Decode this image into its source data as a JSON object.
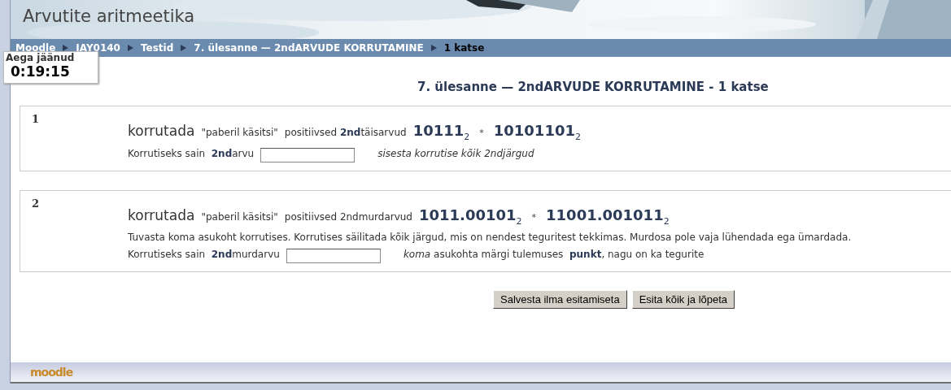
{
  "header": {
    "title": "Arvutite aritmeetika"
  },
  "breadcrumb": [
    {
      "label": "Moodle",
      "current": false
    },
    {
      "label": "IAY0140",
      "current": false
    },
    {
      "label": "Testid",
      "current": false
    },
    {
      "label": "7. ülesanne — 2ndARVUDE KORRUTAMINE",
      "current": false
    },
    {
      "label": "1 katse",
      "current": true
    }
  ],
  "timer": {
    "label": "Aega jäänud",
    "value": "0:19:15"
  },
  "heading": "7. ülesanne — 2ndARVUDE KORRUTAMINE - 1 katse",
  "questions": [
    {
      "number": "1",
      "verb": "korrutada",
      "quote": "\"paberil käsitsi\"",
      "kind_text": "positiivsed **2nd**täisarvud",
      "operand_a": "10111$_{2}$",
      "operator": "*",
      "operand_b": "10101101$_{2}$",
      "answer_label": "Korrutiseks sain  **2nd**arvu",
      "hint": "*sisesta korrutise kõik 2ndjärgud*"
    },
    {
      "number": "2",
      "verb": "korrutada",
      "quote": "\"paberil käsitsi\"",
      "kind_text": "positiivsed 2ndmurdarvud",
      "operand_a": "1011.00101$_{2}$",
      "operator": "*",
      "operand_b": "11001.001011$_{2}$",
      "instruction": "Tuvasta koma asukoht korrutises.  Korrutises säilitada kõik järgud, mis on nendest teguritest tekkimas. Murdosa pole vaja lühendada ega ümardada.",
      "answer_label": "Korrutiseks sain  **2nd**murdarvu",
      "hint": "*koma* asukohta märgi tulemuses  **punkt**, nagu on ka tegurite"
    }
  ],
  "buttons": [
    "Salvesta ilma esitamiseta",
    "Esita kõik ja lõpeta"
  ],
  "footer": {
    "logo": "moodle"
  }
}
